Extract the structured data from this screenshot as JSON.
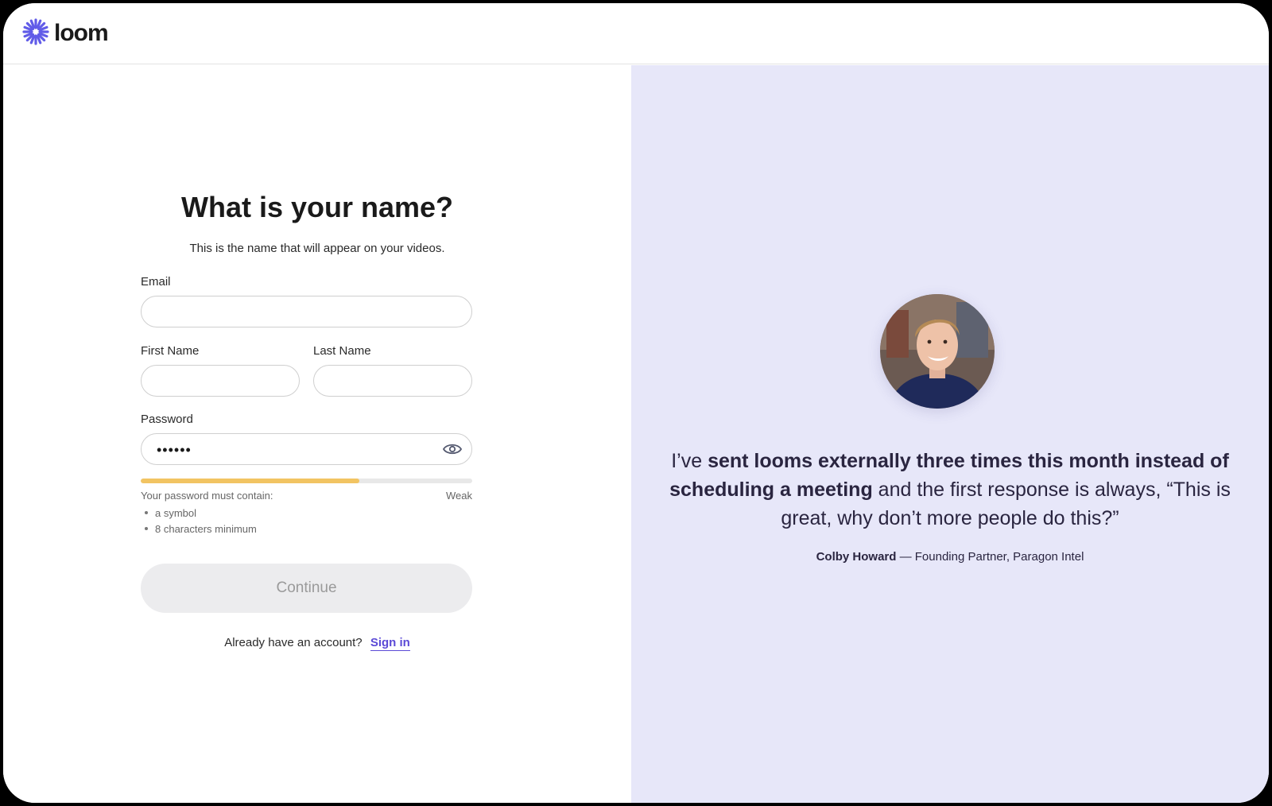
{
  "header": {
    "logo_text": "loom",
    "logo_icon": "loom-asterisk-icon"
  },
  "form": {
    "title": "What is your name?",
    "subtitle": "This is the name that will appear on your videos.",
    "email": {
      "label": "Email",
      "value": "",
      "placeholder": ""
    },
    "first_name": {
      "label": "First Name",
      "value": "",
      "placeholder": ""
    },
    "last_name": {
      "label": "Last Name",
      "value": "",
      "placeholder": ""
    },
    "password": {
      "label": "Password",
      "masked_value": "••••••",
      "toggle_icon": "eye-icon"
    },
    "strength": {
      "level": 0.66,
      "label": "Weak",
      "color": "#f2c462"
    },
    "requirements_title": "Your password must contain:",
    "requirements": [
      "a symbol",
      "8 characters minimum"
    ],
    "continue_label": "Continue",
    "signin_prompt": "Already have an account?",
    "signin_link": "Sign in"
  },
  "testimonial": {
    "quote_pre": "I’ve ",
    "quote_bold": "sent looms externally three times this month instead of scheduling a meeting",
    "quote_post": " and the first response is always, “This is great, why don’t more people do this?”",
    "author": "Colby Howard",
    "author_role": " — Founding Partner, Paragon Intel"
  },
  "colors": {
    "accent": "#5b4ad6",
    "right_panel_bg": "#e7e7f9",
    "button_bg": "#ececee"
  }
}
